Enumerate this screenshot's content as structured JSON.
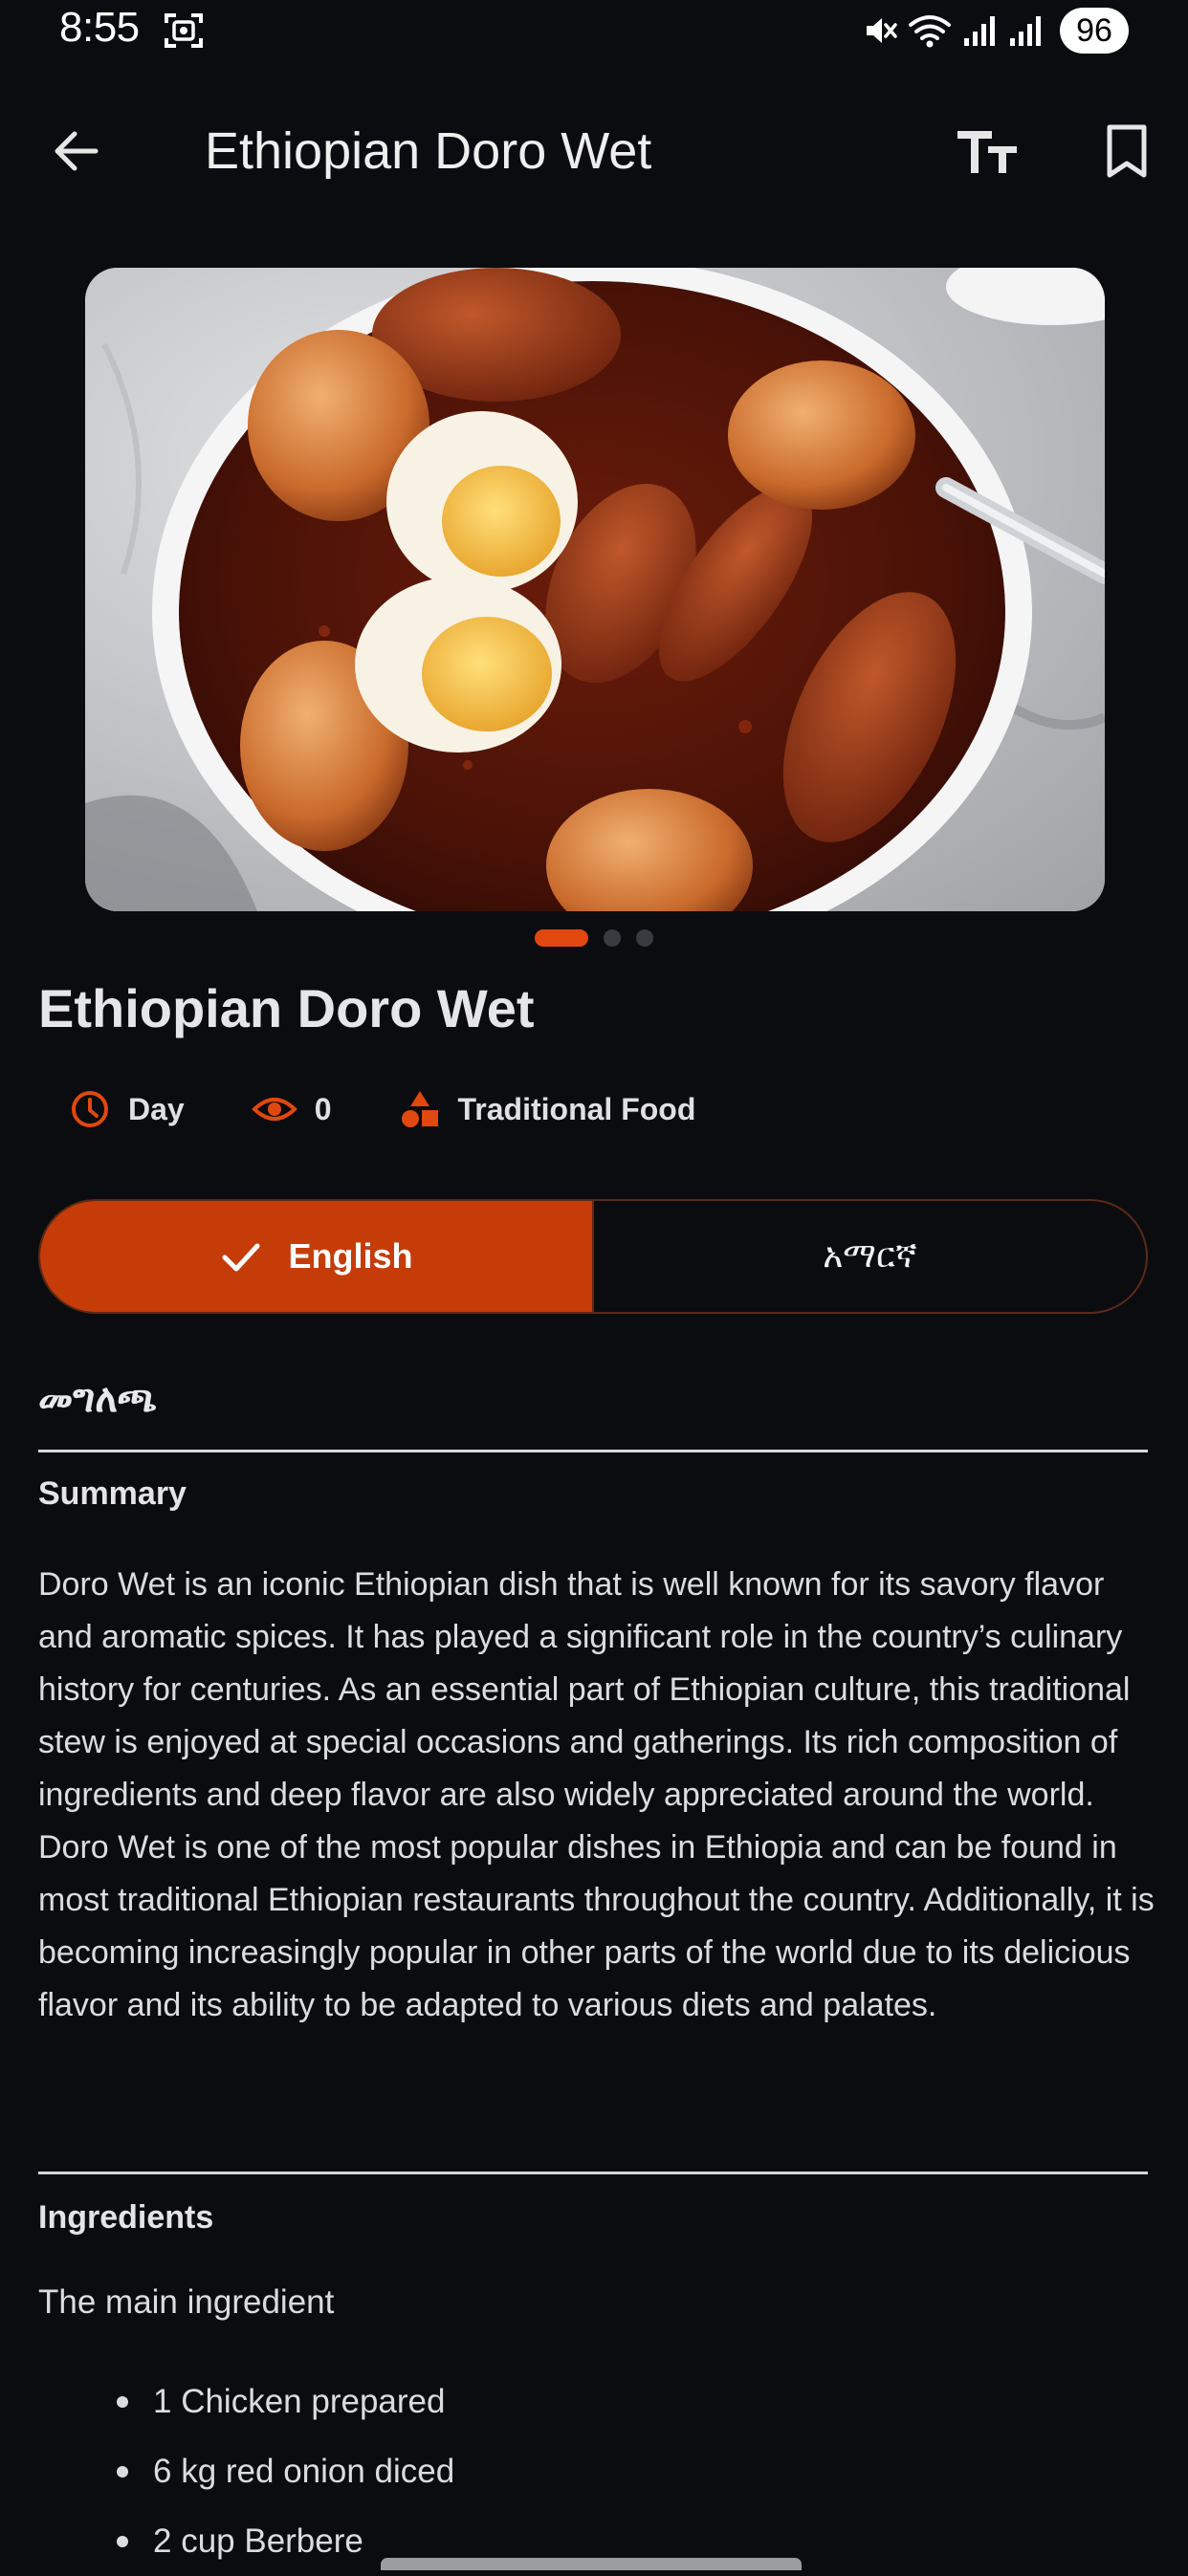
{
  "status_bar": {
    "time": "8:55",
    "battery": "96"
  },
  "app_bar": {
    "title": "Ethiopian Doro Wet",
    "back_icon": "arrow-left-icon",
    "text_size_icon": "text-size-icon",
    "bookmark_icon": "bookmark-icon"
  },
  "carousel": {
    "total": 3,
    "active_index": 0
  },
  "dish": {
    "title": "Ethiopian Doro Wet",
    "meta": {
      "time": "Day",
      "views": "0",
      "category": "Traditional Food"
    }
  },
  "language_toggle": {
    "options": [
      "English",
      "አማርኛ"
    ],
    "selected": "English"
  },
  "content": {
    "section_heading": "መግለጫ",
    "summary_heading": "Summary",
    "summary_text": "Doro Wet is an iconic Ethiopian dish that is well known for its savory flavor and aromatic spices. It has played a significant role in the country’s culinary history for centuries. As an essential part of Ethiopian culture, this traditional stew is enjoyed at special occasions and gatherings. Its rich composition of ingredients and deep flavor are also widely appreciated around the world. Doro Wet is one of the most popular dishes in Ethiopia and can be found in most traditional Ethiopian restaurants throughout the country. Additionally, it is becoming increasingly popular in other parts of the world due to its delicious flavor and its ability to be adapted to various diets and palates.",
    "ingredients_heading": "Ingredients",
    "ingredients_intro": "The main ingredient",
    "ingredients": [
      "1 Chicken prepared",
      "6 kg red onion diced",
      "2 cup Berbere"
    ]
  },
  "colors": {
    "background": "#0b0c0f",
    "accent": "#c53c08",
    "accent_bright": "#e0480f"
  }
}
